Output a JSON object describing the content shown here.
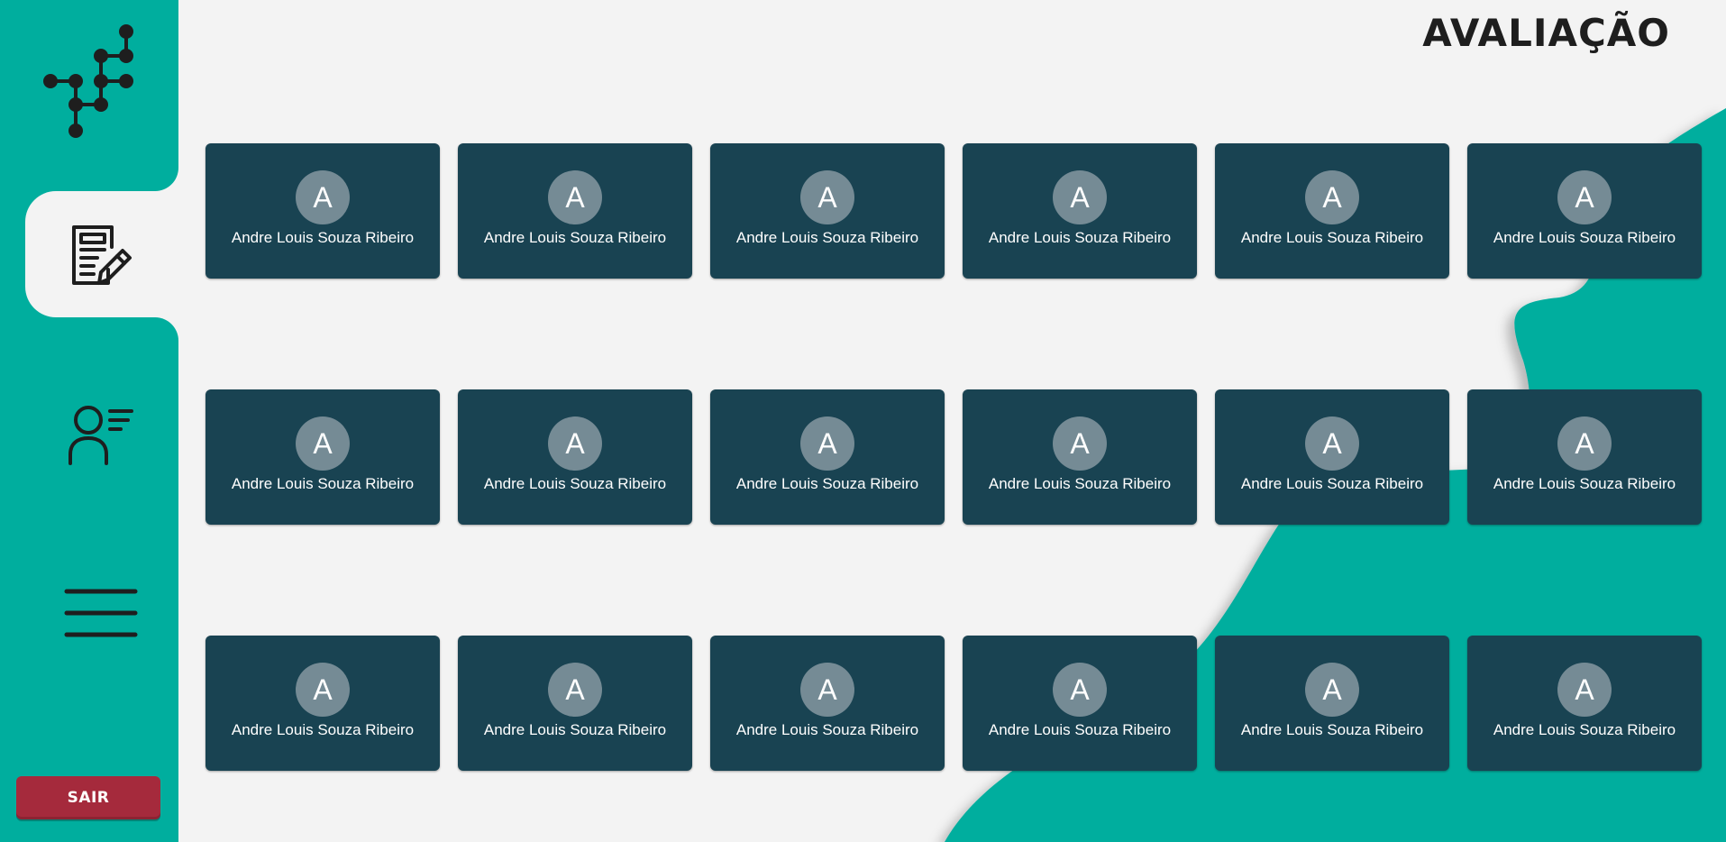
{
  "app": {
    "title": "AVALIAÇÃO",
    "colors": {
      "primary": "#00ae9e",
      "card": "#194352",
      "avatar": "#758b95",
      "logout": "#a52a3c",
      "background": "#f3f3f3"
    }
  },
  "sidebar": {
    "logo_icon": "network-tree-logo-icon",
    "items": [
      {
        "name": "avaliacao",
        "icon": "document-edit-icon",
        "active": true
      },
      {
        "name": "usuarios",
        "icon": "user-list-icon",
        "active": false
      },
      {
        "name": "menu",
        "icon": "hamburger-menu-icon",
        "active": false
      }
    ],
    "logout_label": "SAIR"
  },
  "cards": [
    {
      "initial": "A",
      "name": "Andre Louis Souza Ribeiro"
    },
    {
      "initial": "A",
      "name": "Andre Louis Souza Ribeiro"
    },
    {
      "initial": "A",
      "name": "Andre Louis Souza Ribeiro"
    },
    {
      "initial": "A",
      "name": "Andre Louis Souza Ribeiro"
    },
    {
      "initial": "A",
      "name": "Andre Louis Souza Ribeiro"
    },
    {
      "initial": "A",
      "name": "Andre Louis Souza Ribeiro"
    },
    {
      "initial": "A",
      "name": "Andre Louis Souza Ribeiro"
    },
    {
      "initial": "A",
      "name": "Andre Louis Souza Ribeiro"
    },
    {
      "initial": "A",
      "name": "Andre Louis Souza Ribeiro"
    },
    {
      "initial": "A",
      "name": "Andre Louis Souza Ribeiro"
    },
    {
      "initial": "A",
      "name": "Andre Louis Souza Ribeiro"
    },
    {
      "initial": "A",
      "name": "Andre Louis Souza Ribeiro"
    },
    {
      "initial": "A",
      "name": "Andre Louis Souza Ribeiro"
    },
    {
      "initial": "A",
      "name": "Andre Louis Souza Ribeiro"
    },
    {
      "initial": "A",
      "name": "Andre Louis Souza Ribeiro"
    },
    {
      "initial": "A",
      "name": "Andre Louis Souza Ribeiro"
    },
    {
      "initial": "A",
      "name": "Andre Louis Souza Ribeiro"
    },
    {
      "initial": "A",
      "name": "Andre Louis Souza Ribeiro"
    }
  ]
}
